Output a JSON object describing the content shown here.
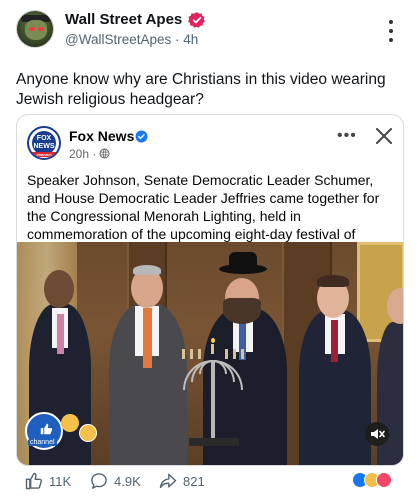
{
  "post": {
    "author": "Wall Street Apes",
    "handle": "@WallStreetApes",
    "time": "4h",
    "text": "Anyone know why are Christians in this video wearing Jewish religious headgear?"
  },
  "card": {
    "author": "Fox News",
    "logo_text": "FOX NEWS",
    "logo_sub": "channel",
    "time": "20h",
    "text": "Speaker Johnson, Senate Democratic Leader Schumer, and House Democratic Leader Jeffries came together for the Congressional Menorah Lighting, held in commemoration of the upcoming eight-day festival of Hanukkah.",
    "more_label": "•••",
    "channel_label": "channel"
  },
  "actions": {
    "likes": "11K",
    "comments": "4.9K",
    "shares": "821"
  },
  "icons": {
    "verified": "verified-badge-icon",
    "more": "more-vertical-icon",
    "globe": "globe-icon",
    "close": "close-icon",
    "mute": "mute-icon",
    "like": "thumbs-up-icon",
    "comment": "comment-icon",
    "share": "share-icon"
  },
  "colors": {
    "verified_pink": "#e0245e",
    "facebook_blue": "#1877f2",
    "fox_blue": "#1b3d8f"
  }
}
